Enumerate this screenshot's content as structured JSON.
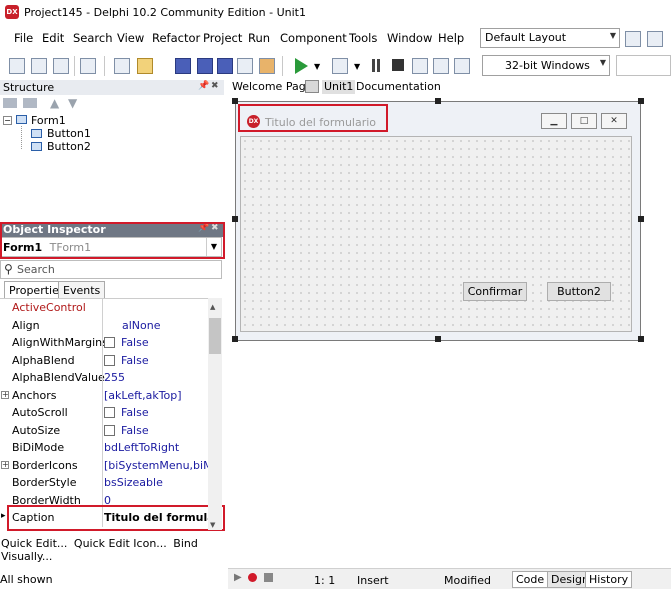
{
  "window": {
    "title": "Project145 - Delphi 10.2 Community Edition - Unit1",
    "app_icon": "DX"
  },
  "menu": [
    "File",
    "Edit",
    "Search",
    "View",
    "Refactor",
    "Project",
    "Run",
    "Component",
    "Tools",
    "Window",
    "Help"
  ],
  "layout_combo": "Default Layout",
  "platform_combo": "32-bit Windows",
  "structure": {
    "header": "Structure",
    "tree": {
      "root": "Form1",
      "children": [
        "Button1",
        "Button2"
      ]
    }
  },
  "object_inspector": {
    "header": "Object Inspector",
    "selected_name": "Form1",
    "selected_type": "TForm1",
    "search_placeholder": "Search",
    "tabs": [
      "Properties",
      "Events"
    ],
    "properties": [
      {
        "name": "ActiveControl",
        "value": ""
      },
      {
        "name": "Align",
        "value": "alNone"
      },
      {
        "name": "AlignWithMargins",
        "value": "False"
      },
      {
        "name": "AlphaBlend",
        "value": "False"
      },
      {
        "name": "AlphaBlendValue",
        "value": "255"
      },
      {
        "name": "Anchors",
        "value": "[akLeft,akTop]"
      },
      {
        "name": "AutoScroll",
        "value": "False"
      },
      {
        "name": "AutoSize",
        "value": "False"
      },
      {
        "name": "BiDiMode",
        "value": "bdLeftToRight"
      },
      {
        "name": "BorderIcons",
        "value": "[biSystemMenu,biMin"
      },
      {
        "name": "BorderStyle",
        "value": "bsSizeable"
      },
      {
        "name": "BorderWidth",
        "value": "0"
      },
      {
        "name": "Caption",
        "value": "Titulo del formulario"
      }
    ],
    "footer_links": [
      "Quick Edit...",
      "Quick Edit Icon...",
      "Bind Visually..."
    ],
    "status": "All shown"
  },
  "editor_tabs": [
    "Welcome Page",
    "Unit1",
    "Documentation"
  ],
  "form": {
    "title": "Titulo del formulario",
    "buttons": [
      "Confirmar",
      "Button2"
    ]
  },
  "statusbar": {
    "position": "1:   1",
    "mode": "Insert",
    "state": "Modified",
    "view_tabs": [
      "Code",
      "Design",
      "History"
    ]
  },
  "colors": {
    "highlight_red": "#d11a2a",
    "oi_header": "#6f7784",
    "prop_value": "#1a1aa0"
  }
}
